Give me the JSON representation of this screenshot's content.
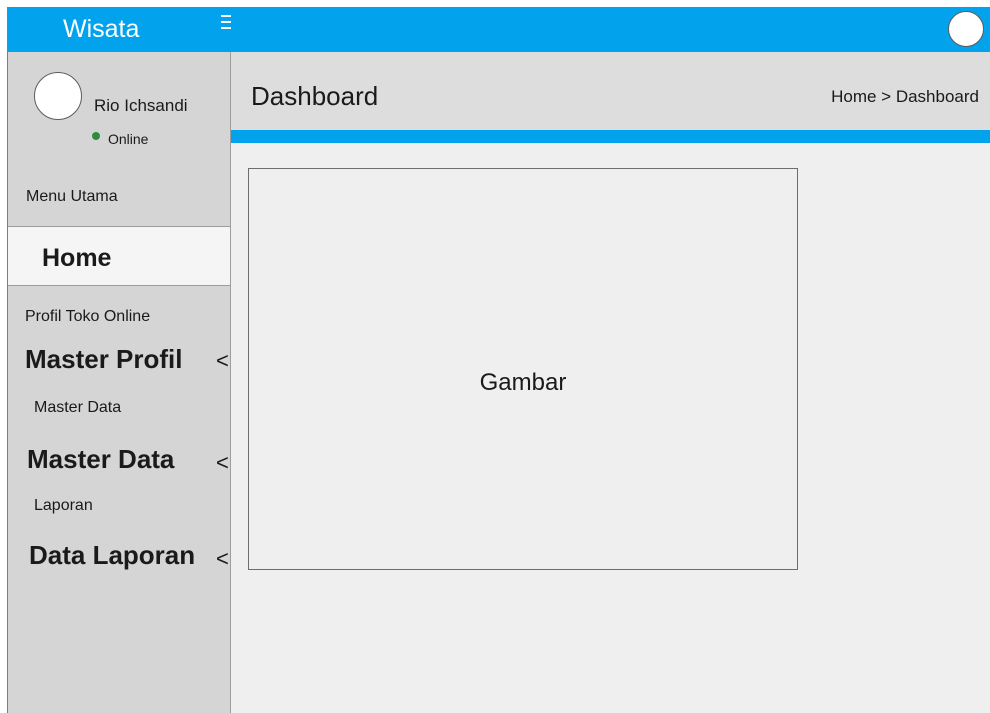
{
  "header": {
    "brand": "Wisata"
  },
  "user": {
    "name": "Rio Ichsandi",
    "status": "Online"
  },
  "sidebar": {
    "sections": [
      {
        "label": "Menu Utama"
      },
      {
        "label": "Profil Toko Online"
      },
      {
        "label": "Master Data"
      },
      {
        "label": "Laporan"
      }
    ],
    "home_label": "Home",
    "items": [
      {
        "label": "Master Profil",
        "chevron": "<"
      },
      {
        "label": "Master Data",
        "chevron": "<"
      },
      {
        "label": "Data Laporan",
        "chevron": "<"
      }
    ]
  },
  "content": {
    "title": "Dashboard",
    "breadcrumb": "Home > Dashboard",
    "image_placeholder": "Gambar"
  },
  "colors": {
    "accent": "#02a3ec",
    "sidebar_bg": "#d5d5d5",
    "content_bg": "#efefef",
    "status_online": "#2d8c3b"
  },
  "icons": {
    "menu": "hamburger-icon",
    "avatar": "user-avatar-icon"
  }
}
